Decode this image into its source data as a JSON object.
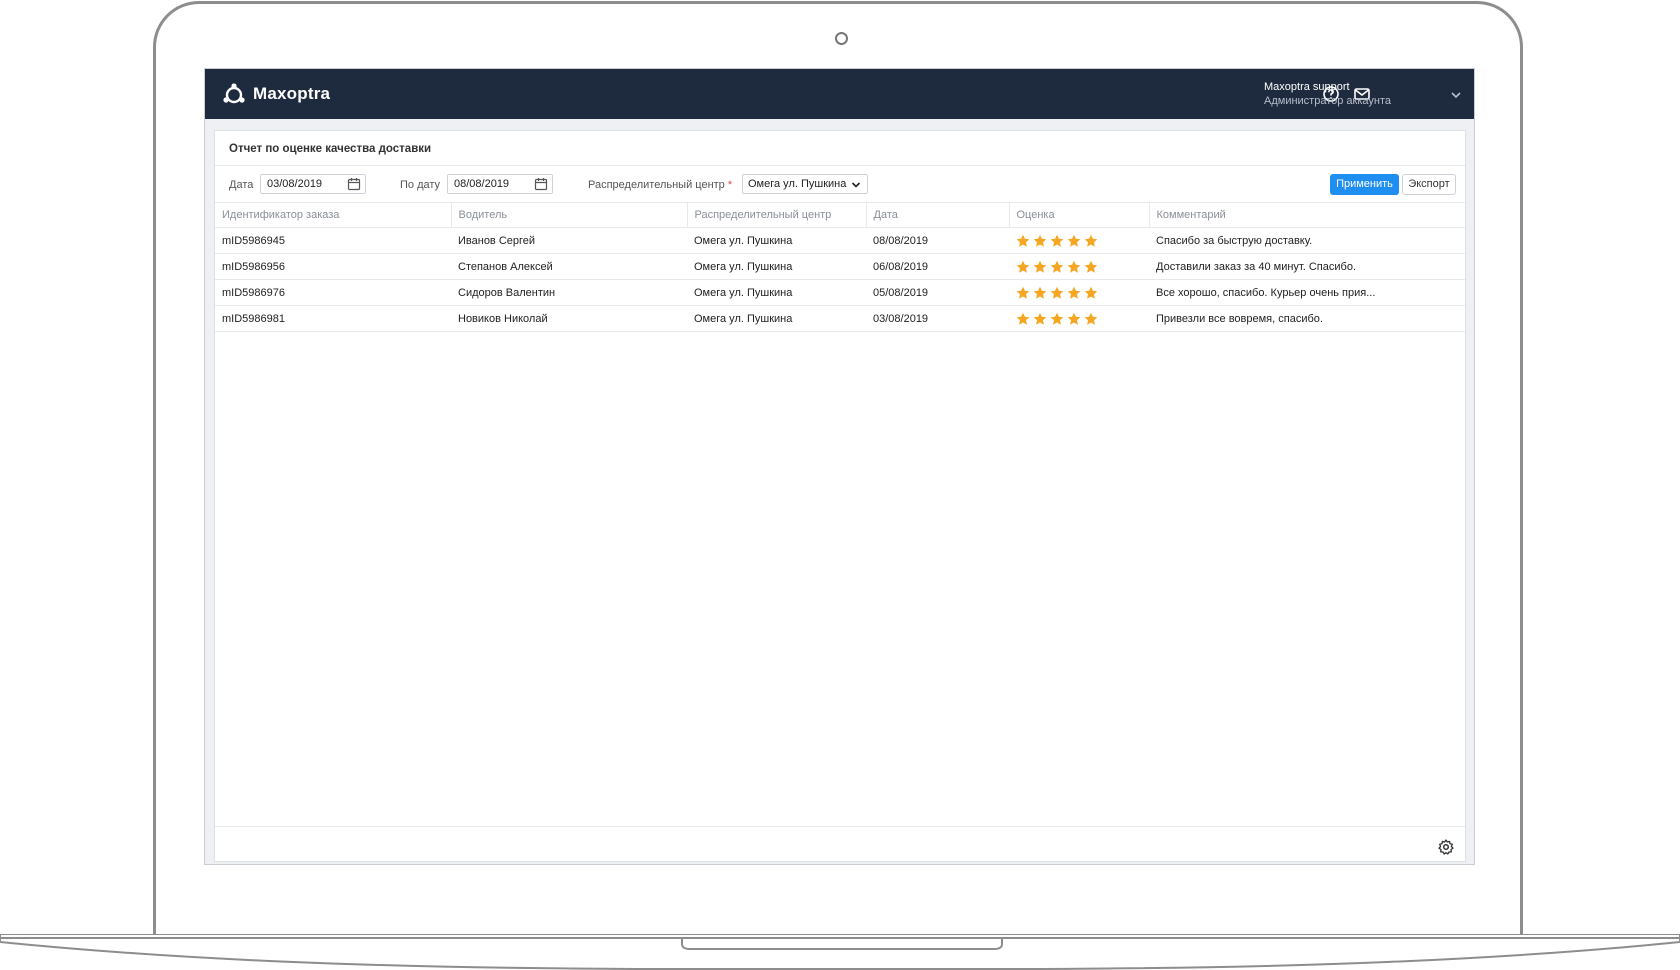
{
  "app": {
    "brand": "Maxoptra"
  },
  "topbar": {
    "help_icon": "help-circle-icon",
    "mail_icon": "mail-icon",
    "user_name": "Maxoptra support",
    "user_role": "Администратор аккаунта"
  },
  "report": {
    "title": "Отчет по оценке качества доставки",
    "filters": {
      "date_from_label": "Дата",
      "date_from_value": "03/08/2019",
      "date_to_label": "По дату",
      "date_to_value": "08/08/2019",
      "center_label": "Распределительный центр",
      "required_mark": "*",
      "center_value": "Омега ул. Пушкина",
      "apply_label": "Применить",
      "export_label": "Экспорт"
    },
    "columns": [
      "Идентификатор заказа",
      "Водитель",
      "Распределительный центр",
      "Дата",
      "Оценка",
      "Комментарий"
    ],
    "rows": [
      {
        "id": "mID5986945",
        "driver": "Иванов Сергей",
        "center": "Омега ул. Пушкина",
        "date": "08/08/2019",
        "rating": 5,
        "comment": "Спасибо за быструю доставку."
      },
      {
        "id": "mID5986956",
        "driver": "Степанов Алексей",
        "center": "Омега ул. Пушкина",
        "date": "06/08/2019",
        "rating": 5,
        "comment": "Доставили заказ за 40 минут. Спасибо."
      },
      {
        "id": "mID5986976",
        "driver": "Сидоров Валентин",
        "center": "Омега ул. Пушкина",
        "date": "05/08/2019",
        "rating": 5,
        "comment": "Все хорошо, спасибо. Курьер очень прия..."
      },
      {
        "id": "mID5986981",
        "driver": "Новиков Николай",
        "center": "Омега ул. Пушкина",
        "date": "03/08/2019",
        "rating": 5,
        "comment": "Привезли все вовремя, спасибо."
      }
    ]
  },
  "colors": {
    "topbar": "#1e2a3d",
    "accent": "#1f8ef1",
    "star": "#f5a623"
  }
}
